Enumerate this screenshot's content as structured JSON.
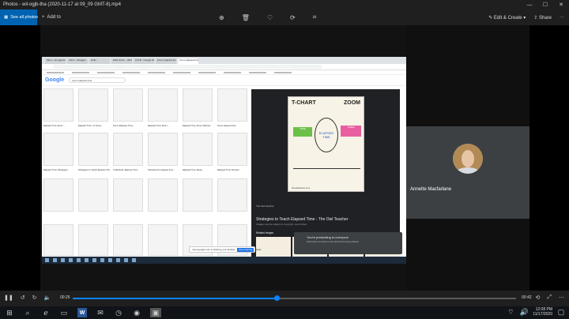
{
  "window": {
    "title": "Photos - wil-ogjb-tha (2020-11-17 at 09_09 GMT-8).mp4",
    "minimize": "—",
    "maximize": "☐",
    "close": "✕"
  },
  "toolbar": {
    "see_all": "See all photos",
    "add_to": "Add to",
    "edit_create": "Edit & Create",
    "share": "Share",
    "more": "···"
  },
  "meeting": {
    "participant_name": "Annette Macfarlane"
  },
  "browser": {
    "google_logo": "Google",
    "query": "zoom elapsed time",
    "tabs": [
      "Meet - wil-ogjb-tha",
      "Inbox - athaggin",
      "Hello",
      "Math Zoom - 2020",
      "GTLB - Google Slides",
      "Zoom elapsed time",
      "zoom elapsed time"
    ],
    "captions": [
      "Elapsed Time Zoom ...",
      "Elapsed Time: 'Z' Zoom...",
      "Zoom Elapsed Time...",
      "Elapsed Time Zoom...",
      "Elapsed Time Zoom Method...",
      "Zoom elapsed time",
      "Elapsed Time Strategies...",
      "Strategies to Teach Elapsed Time...",
      "2 Methods: Elapsed Time",
      "Showing the elapsed time...",
      "Elapsed Time Ideas...",
      "Elapsed Time Number..."
    ],
    "preview": {
      "chart_title_left": "T-CHART",
      "chart_title_right": "ZOOM",
      "oval_text": "ELAPSED TIME",
      "green_label": "TIME",
      "pink_label": "TIMES",
      "credit": "theowlteacher.com",
      "source": "The Owl Teacher",
      "title": "Strategies to Teach Elapsed Time - The Owl Teacher",
      "subtitle": "Images may be subject to copyright. Learn More",
      "related": "Related images"
    },
    "presenting": {
      "line1": "You're presenting to everyone",
      "line2": "Click here to return to the tab that is being shared"
    },
    "sharebar": {
      "text": "meet.google.com is sharing your window",
      "stop": "Stop sharing",
      "hide": "Hide"
    }
  },
  "playback": {
    "current_time": "00:25",
    "total_time": "00:42",
    "progress_fraction": 0.46,
    "left_icons": [
      "pause-icon",
      "rewind-icon",
      "forward-icon",
      "volume-icon"
    ],
    "right_icons": [
      "repeat-icon",
      "fullscreen-icon",
      "more-icon"
    ]
  },
  "taskbar": {
    "time": "12:08 PM",
    "date": "11/17/2020",
    "apps": [
      "start-icon",
      "search-icon",
      "edge-icon",
      "file-explorer-icon",
      "word-icon",
      "mail-icon",
      "clock-icon",
      "chrome-icon",
      "photos-icon"
    ]
  },
  "colors": {
    "accent": "#0063b1",
    "progress": "#0a84ff"
  }
}
